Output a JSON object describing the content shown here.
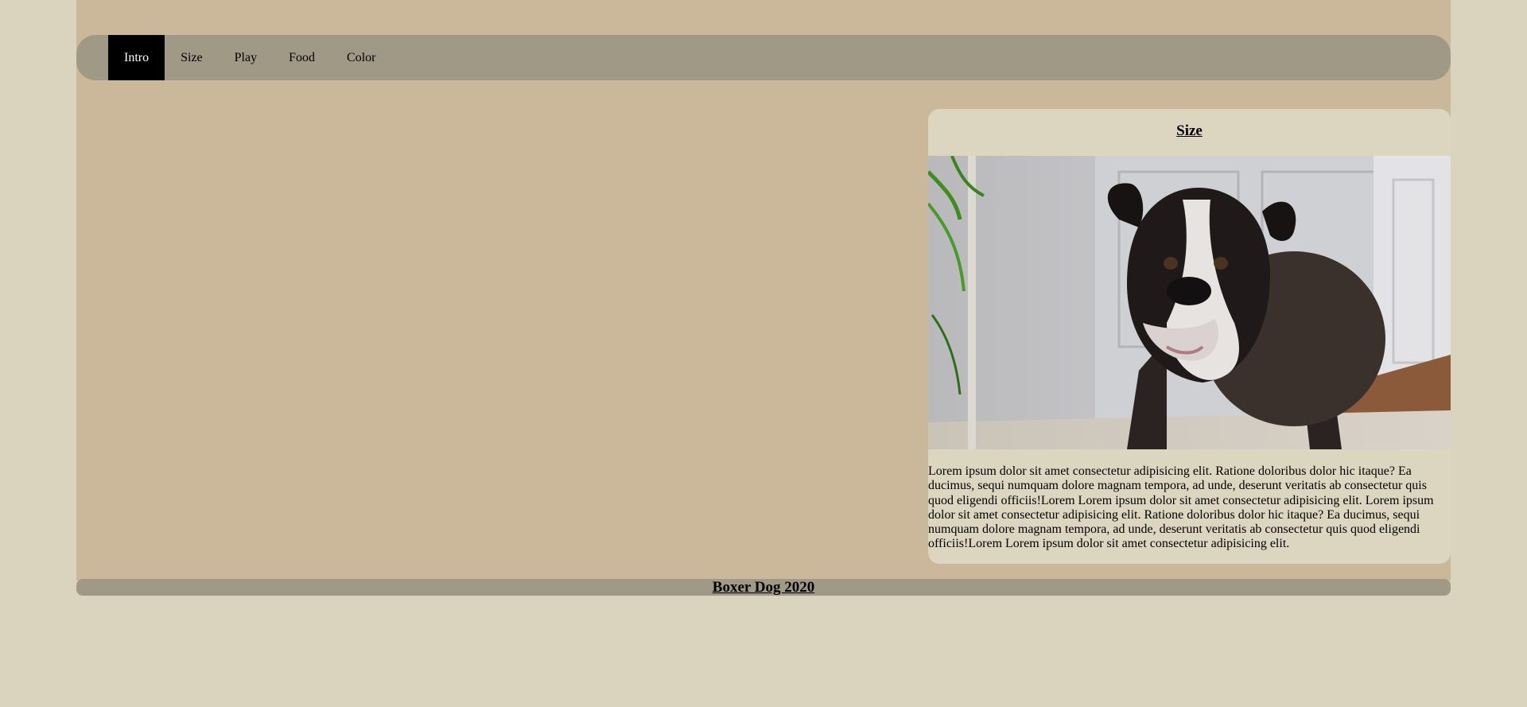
{
  "nav": {
    "items": [
      {
        "label": "Intro",
        "active": true
      },
      {
        "label": "Size",
        "active": false
      },
      {
        "label": "Play",
        "active": false
      },
      {
        "label": "Food",
        "active": false
      },
      {
        "label": "Color",
        "active": false
      }
    ]
  },
  "card": {
    "title": "Size",
    "image_alt": "boxer dog",
    "text": "Lorem ipsum dolor sit amet consectetur adipisicing elit. Ratione doloribus dolor hic itaque? Ea ducimus, sequi numquam dolore magnam tempora, ad unde, deserunt veritatis ab consectetur quis quod eligendi officiis!Lorem Lorem ipsum dolor sit amet consectetur adipisicing elit. Lorem ipsum dolor sit amet consectetur adipisicing elit. Ratione doloribus dolor hic itaque? Ea ducimus, sequi numquam dolore magnam tempora, ad unde, deserunt veritatis ab consectetur quis quod eligendi officiis!Lorem Lorem ipsum dolor sit amet consectetur adipisicing elit."
  },
  "footer": {
    "text": "Boxer Dog 2020"
  },
  "colors": {
    "page_bg": "#dad4bf",
    "content_bg": "#cbb799",
    "nav_bg": "#a09985",
    "active_tab_bg": "#000000",
    "card_bg": "#dcd5c0"
  }
}
